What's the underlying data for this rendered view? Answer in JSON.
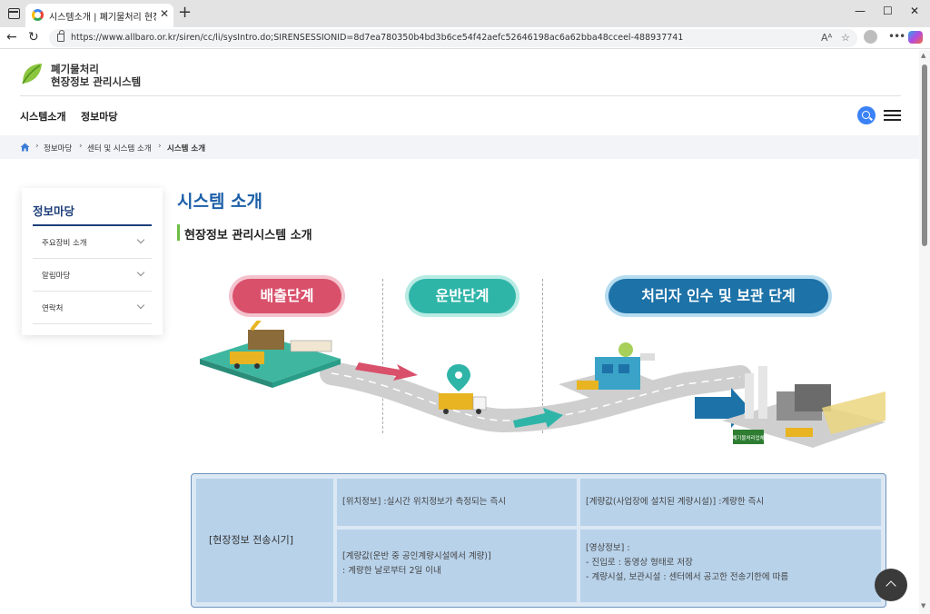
{
  "browser": {
    "tab_title": "시스템소개 | 폐기물처리 현장정보",
    "url": "https://www.allbaro.or.kr/siren/cc/li/sysIntro.do;SIRENSESSIONID=8d7ea780350b4bd3b6ce54f42aefc52646198ac6a62bba48cceel-488937741",
    "read_aloud_label": "Aᴬ"
  },
  "header": {
    "logo_line1": "폐기물처리",
    "logo_line2": "현장정보 관리시스템",
    "nav": [
      "시스템소개",
      "정보마당"
    ]
  },
  "breadcrumb": [
    "정보마당",
    "센터 및 시스템 소개",
    "시스템 소개"
  ],
  "lnb": {
    "title": "정보마당",
    "items": [
      "주요장비 소개",
      "알림마당",
      "연락처"
    ]
  },
  "main": {
    "page_title": "시스템 소개",
    "sub_title": "현장정보 관리시스템 소개",
    "stages": [
      {
        "label": "배출단계",
        "color": "#d9506b"
      },
      {
        "label": "운반단계",
        "color": "#2fb5a8"
      },
      {
        "label": "처리자 인수 및 보관 단계",
        "color": "#1d72a8"
      }
    ],
    "illustration_sign": "폐기물처리업체"
  },
  "info_table": {
    "header": "[현장정보 전송시기]",
    "cells": [
      {
        "lines": [
          "[위치정보] :실시간 위치정보가 측정되는 즉시"
        ]
      },
      {
        "lines": [
          "[계량값(사업장에 설치된 계량시설)] :계량한 즉시"
        ]
      },
      {
        "lines": [
          "[계량값(운반 중 공인계량시설에서 계량)]",
          ": 계량한 날로부터 2일 이내"
        ]
      },
      {
        "lines": [
          "[영상정보] :",
          "- 진입로 : 동영상 형태로 저장",
          "- 계량시설, 보관시설 : 센터에서 공고한 전송기한에 따름"
        ]
      }
    ]
  },
  "colors": {
    "accent": "#1c5fa8",
    "lnb_title": "#1d3f7a",
    "table_border": "#6c93bd",
    "table_cell": "#b8d2ea"
  }
}
